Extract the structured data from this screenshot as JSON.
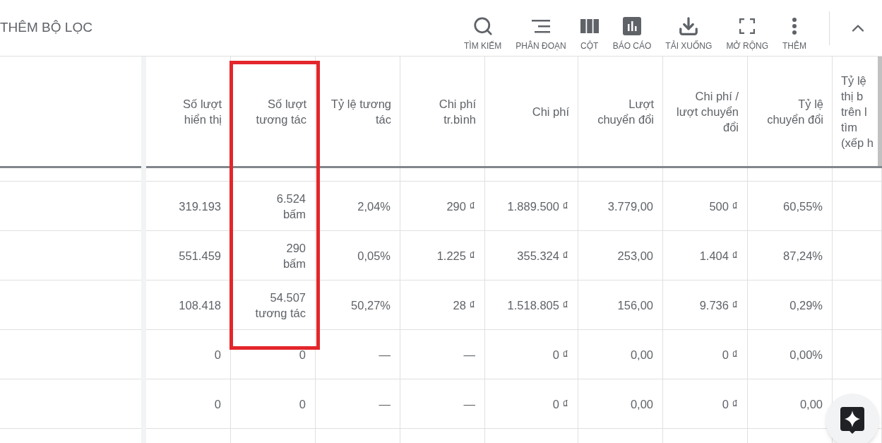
{
  "toolbar": {
    "filter_label": "THÊM BỘ LỌC",
    "actions": [
      {
        "label": "TÌM KIẾM"
      },
      {
        "label": "PHÂN ĐOẠN"
      },
      {
        "label": "CỘT"
      },
      {
        "label": "BÁO CÁO"
      },
      {
        "label": "TẢI XUỐNG"
      },
      {
        "label": "MỞ RỘNG"
      },
      {
        "label": "THÊM"
      }
    ]
  },
  "table": {
    "columns": [
      {
        "label": "Số lượt\nhiển thị",
        "highlighted": false
      },
      {
        "label": "Số lượt\ntương tác",
        "highlighted": true
      },
      {
        "label": "Tỷ lệ tương\ntác",
        "highlighted": false
      },
      {
        "label": "Chi phí\ntr.bình",
        "highlighted": false
      },
      {
        "label": "Chi phí",
        "highlighted": false
      },
      {
        "label": "Lượt\nchuyển đổi",
        "highlighted": false
      },
      {
        "label": "Chi phí /\nlượt chuyển\nđổi",
        "highlighted": false
      },
      {
        "label": "Tỷ lệ\nchuyển đổi",
        "highlighted": false
      },
      {
        "label": "Tỷ lệ\nthị b\ntrên l\ntìm\n(xếp h",
        "highlighted": false
      }
    ],
    "rows": [
      {
        "cells": [
          "319.193",
          "6.524\nbấm",
          "2,04%",
          "290 ₫",
          "1.889.500 ₫",
          "3.779,00",
          "500 ₫",
          "60,55%"
        ]
      },
      {
        "cells": [
          "551.459",
          "290\nbấm",
          "0,05%",
          "1.225 ₫",
          "355.324 ₫",
          "253,00",
          "1.404 ₫",
          "87,24%"
        ]
      },
      {
        "cells": [
          "108.418",
          "54.507\ntương tác",
          "50,27%",
          "28 ₫",
          "1.518.805 ₫",
          "156,00",
          "9.736 ₫",
          "0,29%"
        ]
      },
      {
        "cells": [
          "0",
          "0",
          "—",
          "—",
          "0 ₫",
          "0,00",
          "0 ₫",
          "0,00%"
        ]
      },
      {
        "cells": [
          "0",
          "0",
          "—",
          "—",
          "0 ₫",
          "0,00",
          "0 ₫",
          "0,00"
        ]
      }
    ]
  }
}
